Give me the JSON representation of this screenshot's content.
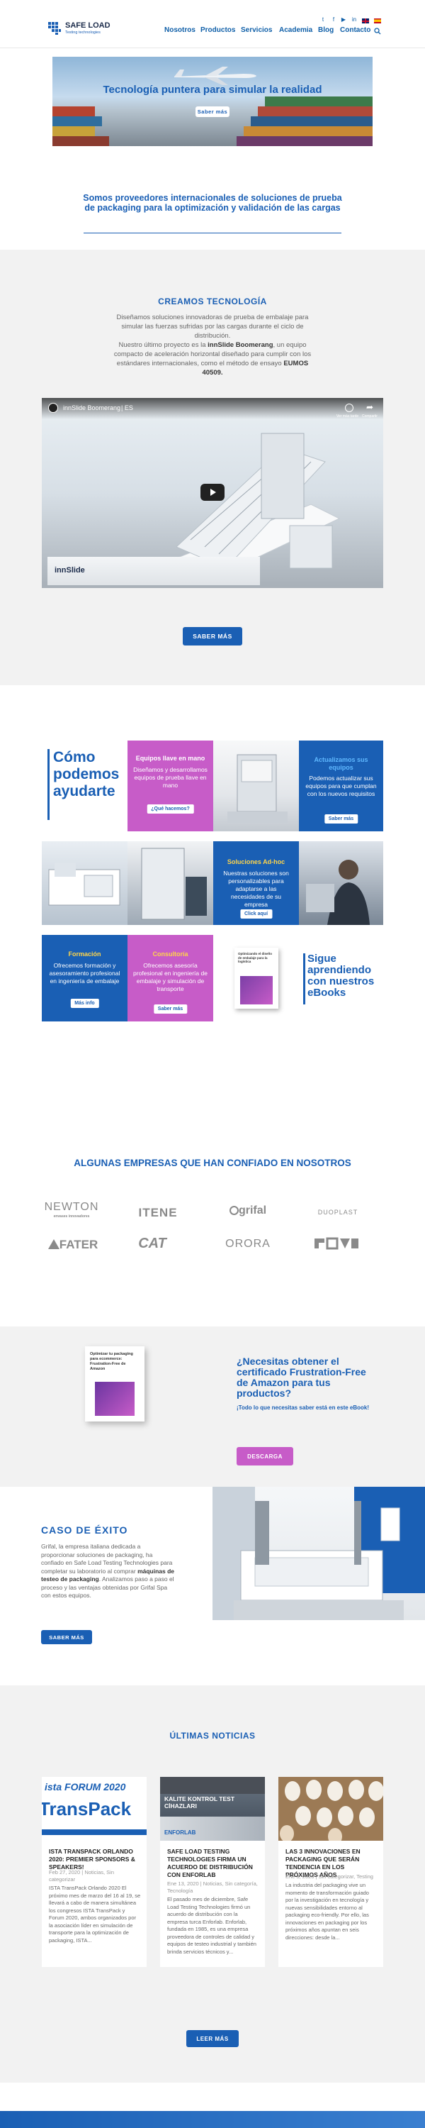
{
  "header": {
    "brand": "SAFE LOAD",
    "tagline": "Testing technologies",
    "nav": [
      "Nosotros",
      "Productos",
      "Servicios",
      "Academia",
      "Blog",
      "Contacto"
    ],
    "social_icons": [
      "twitter-icon",
      "facebook-icon",
      "youtube-icon",
      "linkedin-icon"
    ],
    "flags": [
      "flag-uk",
      "flag-es"
    ]
  },
  "hero": {
    "title": "Tecnología puntera para simular la realidad",
    "button": "Saber más"
  },
  "intro": {
    "heading": "Somos proveedores internacionales de soluciones de prueba de packaging para la optimización y validación de las cargas"
  },
  "technology": {
    "heading": "CREAMOS TECNOLOGÍA",
    "p1": "Diseñamos soluciones innovadoras de prueba de embalaje para simular las fuerzas sufridas por las cargas durante el ciclo de distribución.",
    "p2_a": "Nuestro último proyecto es la ",
    "p2_b": "innSlide Boomerang",
    "p2_c": ", un equipo compacto de aceleración horizontal diseñado para cumplir con los estándares internacionales, como el método de ensayo ",
    "p2_d": "EUMOS 40509.",
    "video_title": "innSlide Boomerang",
    "video_lang": "ES",
    "video_brand": "innSlide",
    "video_later": "Ver más tarde",
    "video_share": "Compartir",
    "button": "SABER MÁS"
  },
  "help": {
    "title": "Cómo podemos ayudarte",
    "tile_equipos_title": "Equipos llave en mano",
    "tile_equipos_text": "Diseñamos y desarrollamos equipos de prueba llave en mano",
    "tile_equipos_btn": "¿Qué hacemos?",
    "tile_actualiza_title": "Actualizamos sus equipos",
    "tile_actualiza_text": "Podemos actualizar sus equipos para que cumplan con los nuevos requisitos",
    "tile_actualiza_btn": "Saber más",
    "tile_adhoc_title": "Soluciones Ad-hoc",
    "tile_adhoc_text": "Nuestras soluciones son personalizables para adaptarse a las necesidades de su empresa",
    "tile_adhoc_btn": "Click aquí",
    "tile_formacion_title": "Formación",
    "tile_formacion_text": "Ofrecemos formación y asesoramiento profesional en ingeniería de embalaje",
    "tile_formacion_btn": "Más info",
    "tile_consultoria_title": "Consultoría",
    "tile_consultoria_text": "Ofrecemos asesoría profesional en ingeniería de embalaje y simulación de transporte",
    "tile_consultoria_btn": "Saber más",
    "ebook_cover": "Optimizando el diseño de embalaje para la logística",
    "ebooks_title": "Sigue aprendiendo con nuestros eBooks"
  },
  "clients": {
    "heading": "ALGUNAS EMPRESAS QUE HAN CONFIADO EN NOSOTROS",
    "logos": [
      "NEWTON",
      "ITENE",
      "grifal",
      "DUOPLAST",
      "FATER",
      "CAT",
      "ORORA",
      "SABORES"
    ],
    "newton_sub": "envases innovadores"
  },
  "amazon": {
    "cover": "Optimizar tu packaging para ecommerce: Frustration-Free de Amazon",
    "heading": "¿Necesitas obtener el certificado Frustration-Free de Amazon para tus productos?",
    "sub": "¡Todo lo que necesitas saber está en este eBook!",
    "button": "DESCARGA"
  },
  "case": {
    "heading": "CASO DE ÉXITO",
    "text_a": "Grifal, la empresa italiana dedicada a proporcionar soluciones de packaging, ha confiado en Safe Load Testing Technologies para completar su laboratorio al comprar ",
    "text_b": "máquinas de testeo de packaging",
    "text_c": ". Analizamos paso a paso el proceso y las ventajas obtenidas por Grifal Spa con estos equipos.",
    "button": "SABER MÁS"
  },
  "news": {
    "heading": "ÚLTIMAS NOTICIAS",
    "items": [
      {
        "img1": "ista FORUM 2020",
        "img2": "TransPack",
        "title": "ISTA TRANSPACK ORLANDO 2020: PREMIER SPONSORS & SPEAKERS!",
        "meta": "Feb 27, 2020 | Noticias, Sin categorizar",
        "excerpt": "ISTA TransPack Orlando 2020 El próximo mes de marzo del 16 al 19, se llevará a cabo de manera simultánea los congresos ISTA TransPack y Forum 2020, ambos organizados por la asociación líder en simulación de transporte para la optimización de packaging, ISTA..."
      },
      {
        "img1": "KALITE KONTROL TEST CİHAZLARI",
        "img2": "ENFORLAB",
        "title": "SAFE LOAD TESTING TECHNOLOGIES FIRMA UN ACUERDO DE DISTRIBUCIÓN CON ENFORLAB",
        "meta": "Ene 13, 2020 | Noticias, Sin categoría, Tecnología",
        "excerpt": "El pasado mes de diciembre, Safe Load Testing Technologies firmó un acuerdo de distribución con la empresa turca Enforlab. Enforlab, fundada en 1985, es una empresa proveedora de controles de calidad y equipos de testeo industrial y también brinda servicios técnicos y..."
      },
      {
        "img1": "",
        "img2": "",
        "title": "LAS 3 INNOVACIONES EN PACKAGING QUE SERÁN TENDENCIA EN LOS PRÓXIMOS AÑOS",
        "meta": "Ene 3, 2020 | Sin categorizar, Testing",
        "excerpt": "La industria del packaging vive un momento de transformación guiado por la investigación en tecnología y nuevas sensibilidades entorno al packaging eco-friendly. Por ello, las innovaciones en packaging por los próximos años apuntan en seis direcciones: desde la..."
      }
    ],
    "button": "LEER MÁS"
  },
  "colors": {
    "brand": "#1a5fb4",
    "accent_purple": "#c75cc8",
    "section_gray": "#f2f2f2"
  }
}
